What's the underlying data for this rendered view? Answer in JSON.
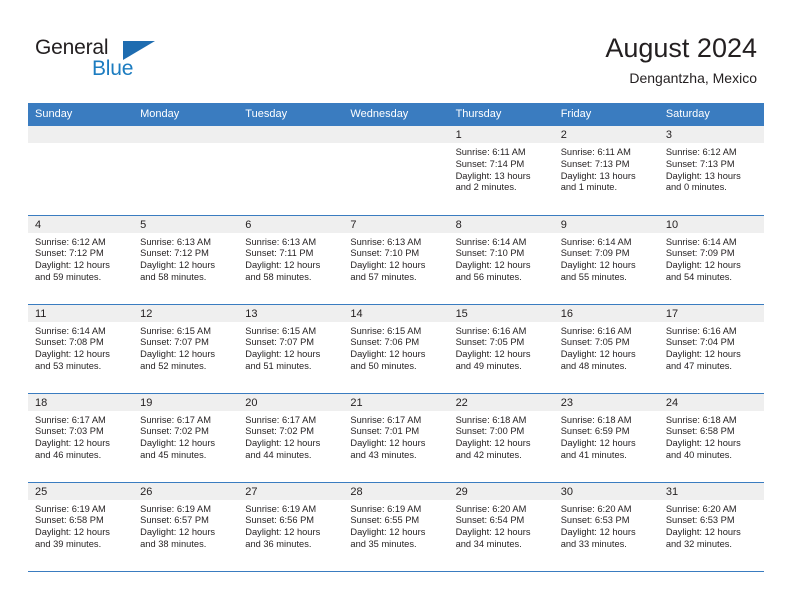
{
  "brand": {
    "name_part1": "General",
    "name_part2": "Blue",
    "accent_color": "#1c7cc0"
  },
  "header": {
    "title": "August 2024",
    "subtitle": "Dengantzha, Mexico"
  },
  "theme": {
    "header_bg": "#3a7cc0",
    "daynum_bg": "#efefef",
    "text_color": "#231f20"
  },
  "weekday_headers": [
    "Sunday",
    "Monday",
    "Tuesday",
    "Wednesday",
    "Thursday",
    "Friday",
    "Saturday"
  ],
  "weeks": [
    [
      {
        "day": "",
        "empty": true,
        "sunrise": "",
        "sunset": "",
        "daylight_line1": "",
        "daylight_line2": ""
      },
      {
        "day": "",
        "empty": true,
        "sunrise": "",
        "sunset": "",
        "daylight_line1": "",
        "daylight_line2": ""
      },
      {
        "day": "",
        "empty": true,
        "sunrise": "",
        "sunset": "",
        "daylight_line1": "",
        "daylight_line2": ""
      },
      {
        "day": "",
        "empty": true,
        "sunrise": "",
        "sunset": "",
        "daylight_line1": "",
        "daylight_line2": ""
      },
      {
        "day": "1",
        "empty": false,
        "sunrise": "Sunrise: 6:11 AM",
        "sunset": "Sunset: 7:14 PM",
        "daylight_line1": "Daylight: 13 hours",
        "daylight_line2": "and 2 minutes."
      },
      {
        "day": "2",
        "empty": false,
        "sunrise": "Sunrise: 6:11 AM",
        "sunset": "Sunset: 7:13 PM",
        "daylight_line1": "Daylight: 13 hours",
        "daylight_line2": "and 1 minute."
      },
      {
        "day": "3",
        "empty": false,
        "sunrise": "Sunrise: 6:12 AM",
        "sunset": "Sunset: 7:13 PM",
        "daylight_line1": "Daylight: 13 hours",
        "daylight_line2": "and 0 minutes."
      }
    ],
    [
      {
        "day": "4",
        "empty": false,
        "sunrise": "Sunrise: 6:12 AM",
        "sunset": "Sunset: 7:12 PM",
        "daylight_line1": "Daylight: 12 hours",
        "daylight_line2": "and 59 minutes."
      },
      {
        "day": "5",
        "empty": false,
        "sunrise": "Sunrise: 6:13 AM",
        "sunset": "Sunset: 7:12 PM",
        "daylight_line1": "Daylight: 12 hours",
        "daylight_line2": "and 58 minutes."
      },
      {
        "day": "6",
        "empty": false,
        "sunrise": "Sunrise: 6:13 AM",
        "sunset": "Sunset: 7:11 PM",
        "daylight_line1": "Daylight: 12 hours",
        "daylight_line2": "and 58 minutes."
      },
      {
        "day": "7",
        "empty": false,
        "sunrise": "Sunrise: 6:13 AM",
        "sunset": "Sunset: 7:10 PM",
        "daylight_line1": "Daylight: 12 hours",
        "daylight_line2": "and 57 minutes."
      },
      {
        "day": "8",
        "empty": false,
        "sunrise": "Sunrise: 6:14 AM",
        "sunset": "Sunset: 7:10 PM",
        "daylight_line1": "Daylight: 12 hours",
        "daylight_line2": "and 56 minutes."
      },
      {
        "day": "9",
        "empty": false,
        "sunrise": "Sunrise: 6:14 AM",
        "sunset": "Sunset: 7:09 PM",
        "daylight_line1": "Daylight: 12 hours",
        "daylight_line2": "and 55 minutes."
      },
      {
        "day": "10",
        "empty": false,
        "sunrise": "Sunrise: 6:14 AM",
        "sunset": "Sunset: 7:09 PM",
        "daylight_line1": "Daylight: 12 hours",
        "daylight_line2": "and 54 minutes."
      }
    ],
    [
      {
        "day": "11",
        "empty": false,
        "sunrise": "Sunrise: 6:14 AM",
        "sunset": "Sunset: 7:08 PM",
        "daylight_line1": "Daylight: 12 hours",
        "daylight_line2": "and 53 minutes."
      },
      {
        "day": "12",
        "empty": false,
        "sunrise": "Sunrise: 6:15 AM",
        "sunset": "Sunset: 7:07 PM",
        "daylight_line1": "Daylight: 12 hours",
        "daylight_line2": "and 52 minutes."
      },
      {
        "day": "13",
        "empty": false,
        "sunrise": "Sunrise: 6:15 AM",
        "sunset": "Sunset: 7:07 PM",
        "daylight_line1": "Daylight: 12 hours",
        "daylight_line2": "and 51 minutes."
      },
      {
        "day": "14",
        "empty": false,
        "sunrise": "Sunrise: 6:15 AM",
        "sunset": "Sunset: 7:06 PM",
        "daylight_line1": "Daylight: 12 hours",
        "daylight_line2": "and 50 minutes."
      },
      {
        "day": "15",
        "empty": false,
        "sunrise": "Sunrise: 6:16 AM",
        "sunset": "Sunset: 7:05 PM",
        "daylight_line1": "Daylight: 12 hours",
        "daylight_line2": "and 49 minutes."
      },
      {
        "day": "16",
        "empty": false,
        "sunrise": "Sunrise: 6:16 AM",
        "sunset": "Sunset: 7:05 PM",
        "daylight_line1": "Daylight: 12 hours",
        "daylight_line2": "and 48 minutes."
      },
      {
        "day": "17",
        "empty": false,
        "sunrise": "Sunrise: 6:16 AM",
        "sunset": "Sunset: 7:04 PM",
        "daylight_line1": "Daylight: 12 hours",
        "daylight_line2": "and 47 minutes."
      }
    ],
    [
      {
        "day": "18",
        "empty": false,
        "sunrise": "Sunrise: 6:17 AM",
        "sunset": "Sunset: 7:03 PM",
        "daylight_line1": "Daylight: 12 hours",
        "daylight_line2": "and 46 minutes."
      },
      {
        "day": "19",
        "empty": false,
        "sunrise": "Sunrise: 6:17 AM",
        "sunset": "Sunset: 7:02 PM",
        "daylight_line1": "Daylight: 12 hours",
        "daylight_line2": "and 45 minutes."
      },
      {
        "day": "20",
        "empty": false,
        "sunrise": "Sunrise: 6:17 AM",
        "sunset": "Sunset: 7:02 PM",
        "daylight_line1": "Daylight: 12 hours",
        "daylight_line2": "and 44 minutes."
      },
      {
        "day": "21",
        "empty": false,
        "sunrise": "Sunrise: 6:17 AM",
        "sunset": "Sunset: 7:01 PM",
        "daylight_line1": "Daylight: 12 hours",
        "daylight_line2": "and 43 minutes."
      },
      {
        "day": "22",
        "empty": false,
        "sunrise": "Sunrise: 6:18 AM",
        "sunset": "Sunset: 7:00 PM",
        "daylight_line1": "Daylight: 12 hours",
        "daylight_line2": "and 42 minutes."
      },
      {
        "day": "23",
        "empty": false,
        "sunrise": "Sunrise: 6:18 AM",
        "sunset": "Sunset: 6:59 PM",
        "daylight_line1": "Daylight: 12 hours",
        "daylight_line2": "and 41 minutes."
      },
      {
        "day": "24",
        "empty": false,
        "sunrise": "Sunrise: 6:18 AM",
        "sunset": "Sunset: 6:58 PM",
        "daylight_line1": "Daylight: 12 hours",
        "daylight_line2": "and 40 minutes."
      }
    ],
    [
      {
        "day": "25",
        "empty": false,
        "sunrise": "Sunrise: 6:19 AM",
        "sunset": "Sunset: 6:58 PM",
        "daylight_line1": "Daylight: 12 hours",
        "daylight_line2": "and 39 minutes."
      },
      {
        "day": "26",
        "empty": false,
        "sunrise": "Sunrise: 6:19 AM",
        "sunset": "Sunset: 6:57 PM",
        "daylight_line1": "Daylight: 12 hours",
        "daylight_line2": "and 38 minutes."
      },
      {
        "day": "27",
        "empty": false,
        "sunrise": "Sunrise: 6:19 AM",
        "sunset": "Sunset: 6:56 PM",
        "daylight_line1": "Daylight: 12 hours",
        "daylight_line2": "and 36 minutes."
      },
      {
        "day": "28",
        "empty": false,
        "sunrise": "Sunrise: 6:19 AM",
        "sunset": "Sunset: 6:55 PM",
        "daylight_line1": "Daylight: 12 hours",
        "daylight_line2": "and 35 minutes."
      },
      {
        "day": "29",
        "empty": false,
        "sunrise": "Sunrise: 6:20 AM",
        "sunset": "Sunset: 6:54 PM",
        "daylight_line1": "Daylight: 12 hours",
        "daylight_line2": "and 34 minutes."
      },
      {
        "day": "30",
        "empty": false,
        "sunrise": "Sunrise: 6:20 AM",
        "sunset": "Sunset: 6:53 PM",
        "daylight_line1": "Daylight: 12 hours",
        "daylight_line2": "and 33 minutes."
      },
      {
        "day": "31",
        "empty": false,
        "sunrise": "Sunrise: 6:20 AM",
        "sunset": "Sunset: 6:53 PM",
        "daylight_line1": "Daylight: 12 hours",
        "daylight_line2": "and 32 minutes."
      }
    ]
  ]
}
